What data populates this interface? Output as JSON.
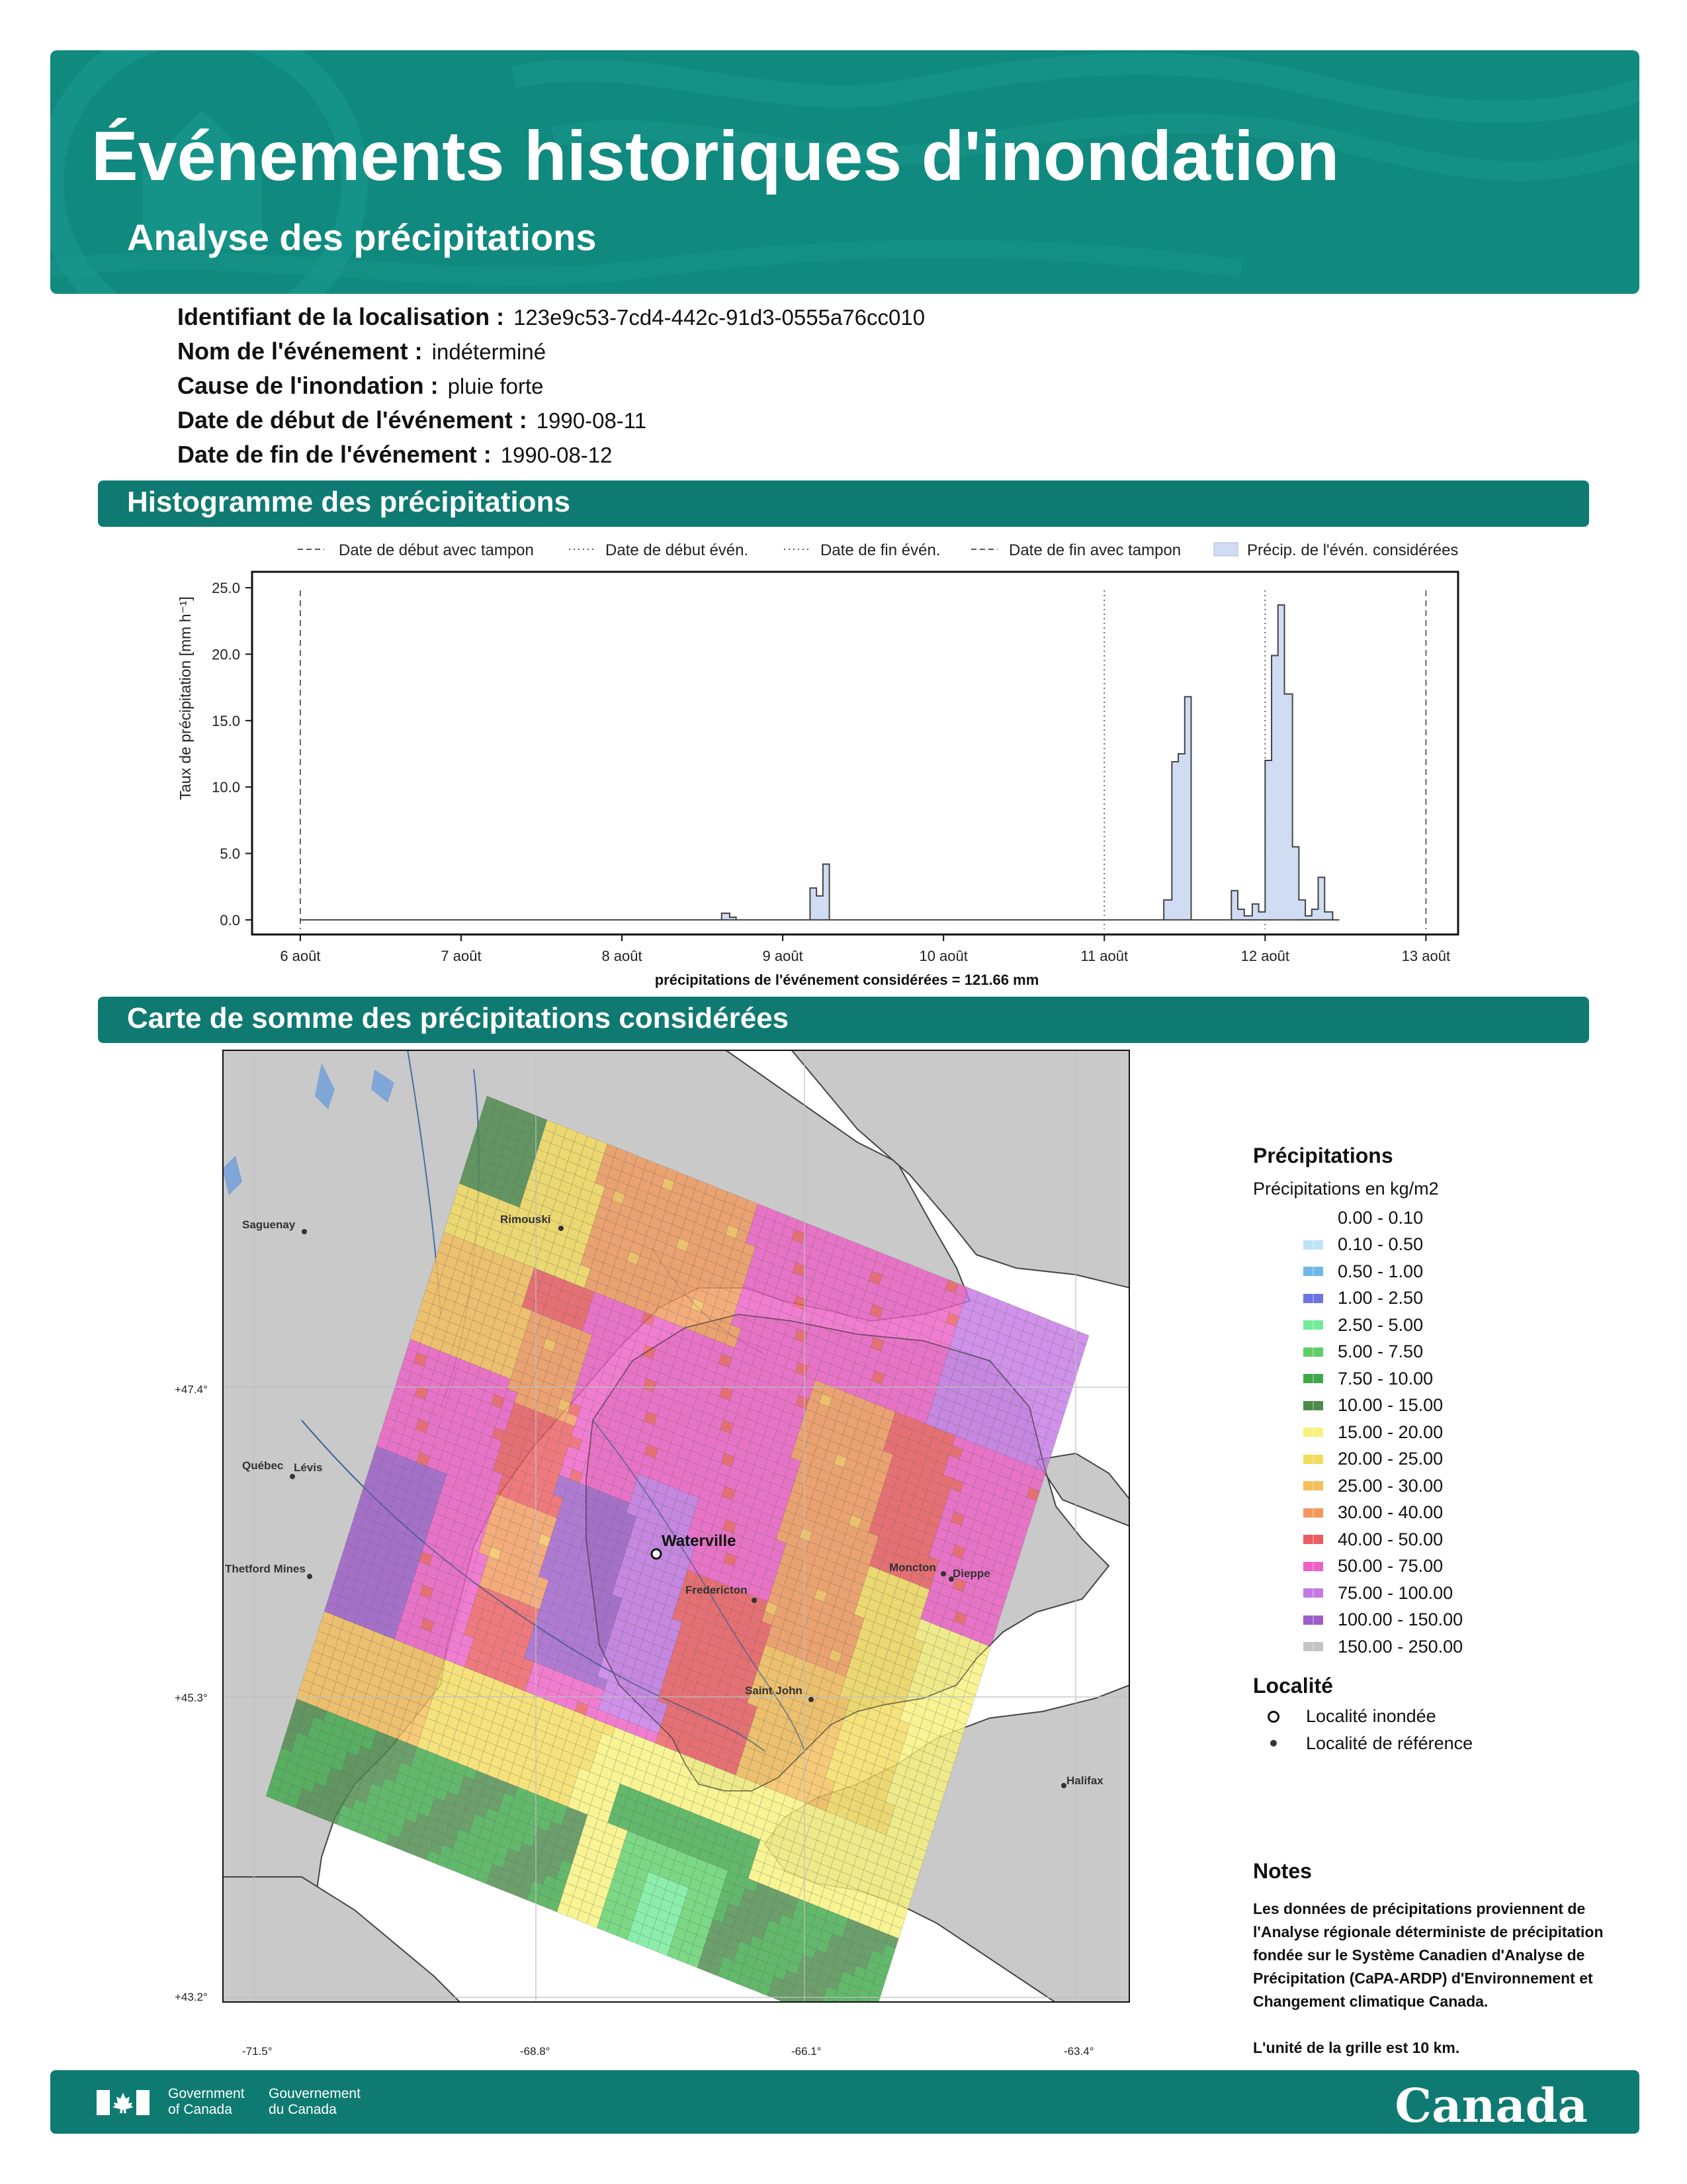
{
  "header": {
    "title": "Événements historiques d'inondation",
    "subtitle": "Analyse des précipitations"
  },
  "info": [
    {
      "label": "Identifiant de la localisation :",
      "value": "123e9c53-7cd4-442c-91d3-0555a76cc010"
    },
    {
      "label": "Nom de l'événement :",
      "value": "indéterminé"
    },
    {
      "label": "Cause de l'inondation :",
      "value": "pluie forte"
    },
    {
      "label": "Date de début de l'événement :",
      "value": "1990-08-11"
    },
    {
      "label": "Date de fin de l'événement :",
      "value": "1990-08-12"
    }
  ],
  "sections": {
    "histogram": "Histogramme des précipitations",
    "map": "Carte de somme des précipitations considérées"
  },
  "chart_data": {
    "type": "area",
    "ylabel": "Taux de précipitation [mm h⁻¹]",
    "xlabel": "précipitations de l'événement considérées = 121.66 mm",
    "ylim": [
      0,
      25
    ],
    "yticks": [
      "0.0",
      "5.0",
      "10.0",
      "15.0",
      "20.0",
      "25.0"
    ],
    "xticks": [
      "6 août",
      "7 août",
      "8 août",
      "9 août",
      "10 août",
      "11 août",
      "12 août",
      "13 août"
    ],
    "xlim_days": [
      5.7,
      13.2
    ],
    "legend": [
      "Date de début avec tampon",
      "Date de début évén.",
      "Date de fin évén.",
      "Date de fin avec tampon",
      "Précip. de l'évén. considérées"
    ],
    "legend_position": "top",
    "grid": false,
    "vlines": [
      {
        "day": 6.0,
        "style": "dashed"
      },
      {
        "day": 11.0,
        "style": "dotted"
      },
      {
        "day": 12.0,
        "style": "dotted"
      },
      {
        "day": 13.0,
        "style": "dashed"
      }
    ],
    "series": [
      {
        "name": "Précip. de l'évén. considérées",
        "step_hours": 1,
        "points": [
          [
            6.0,
            0
          ],
          [
            8.58,
            0
          ],
          [
            8.62,
            0.5
          ],
          [
            8.67,
            0.2
          ],
          [
            8.71,
            0
          ],
          [
            9.12,
            0
          ],
          [
            9.17,
            2.4
          ],
          [
            9.21,
            1.8
          ],
          [
            9.25,
            4.2
          ],
          [
            9.29,
            0
          ],
          [
            11.33,
            0
          ],
          [
            11.37,
            1.5
          ],
          [
            11.42,
            11.9
          ],
          [
            11.46,
            12.5
          ],
          [
            11.5,
            16.8
          ],
          [
            11.54,
            0
          ],
          [
            11.75,
            0
          ],
          [
            11.79,
            2.2
          ],
          [
            11.83,
            0.8
          ],
          [
            11.87,
            0.3
          ],
          [
            11.92,
            1.2
          ],
          [
            11.96,
            0.6
          ],
          [
            12.0,
            12.0
          ],
          [
            12.04,
            19.9
          ],
          [
            12.08,
            23.7
          ],
          [
            12.12,
            17.0
          ],
          [
            12.17,
            5.5
          ],
          [
            12.21,
            1.5
          ],
          [
            12.25,
            0.3
          ],
          [
            12.29,
            0.8
          ],
          [
            12.33,
            3.2
          ],
          [
            12.37,
            0.6
          ],
          [
            12.42,
            0
          ]
        ]
      }
    ]
  },
  "map": {
    "lat_labels": [
      "+47.4°",
      "+45.3°",
      "+43.2°"
    ],
    "lon_labels": [
      "-71.5°",
      "-68.8°",
      "-66.1°",
      "-63.4°"
    ],
    "places": [
      "Saguenay",
      "Rimouski",
      "Québec",
      "Lévis",
      "Thetford Mines",
      "Waterville",
      "Fredericton",
      "Moncton",
      "Dieppe",
      "Saint John",
      "Halifax"
    ]
  },
  "legend": {
    "precip_title": "Précipitations",
    "precip_subtitle": "Précipitations en kg/m2",
    "bins": [
      {
        "label": "0.00 - 0.10",
        "color": "#ffffff"
      },
      {
        "label": "0.10 - 0.50",
        "color": "#bfe3f6"
      },
      {
        "label": "0.50 - 1.00",
        "color": "#6fb7ea"
      },
      {
        "label": "1.00 - 2.50",
        "color": "#6b74e2"
      },
      {
        "label": "2.50 - 5.00",
        "color": "#72eb99"
      },
      {
        "label": "5.00 - 7.50",
        "color": "#5ed06a"
      },
      {
        "label": "7.50 - 10.00",
        "color": "#3fa84a"
      },
      {
        "label": "10.00 - 15.00",
        "color": "#4c8a4a"
      },
      {
        "label": "15.00 - 20.00",
        "color": "#f7f27c"
      },
      {
        "label": "20.00 - 25.00",
        "color": "#f3dc5e"
      },
      {
        "label": "25.00 - 30.00",
        "color": "#f4be5a"
      },
      {
        "label": "30.00 - 40.00",
        "color": "#f29a5e"
      },
      {
        "label": "40.00 - 50.00",
        "color": "#ec5d62"
      },
      {
        "label": "50.00 - 75.00",
        "color": "#ee60c6"
      },
      {
        "label": "75.00 - 100.00",
        "color": "#c579e4"
      },
      {
        "label": "100.00 - 150.00",
        "color": "#9e5ec8"
      },
      {
        "label": "150.00 - 250.00",
        "color": "#c4c4c4"
      }
    ],
    "locality_title": "Localité",
    "locality_flooded": "Localité inondée",
    "locality_reference": "Localité de référence"
  },
  "notes": {
    "title": "Notes",
    "text": "Les données de précipitations proviennent de l'Analyse régionale déterministe de précipitation fondée sur le Système Canadien d'Analyse de Précipitation (CaPA-ARDP) d'Environnement et Changement climatique Canada.",
    "grid_note": "L'unité de la grille est 10 km."
  },
  "footer": {
    "gov_en_1": "Government",
    "gov_en_2": "of Canada",
    "gov_fr_1": "Gouvernement",
    "gov_fr_2": "du Canada",
    "wordmark": "Canada"
  }
}
